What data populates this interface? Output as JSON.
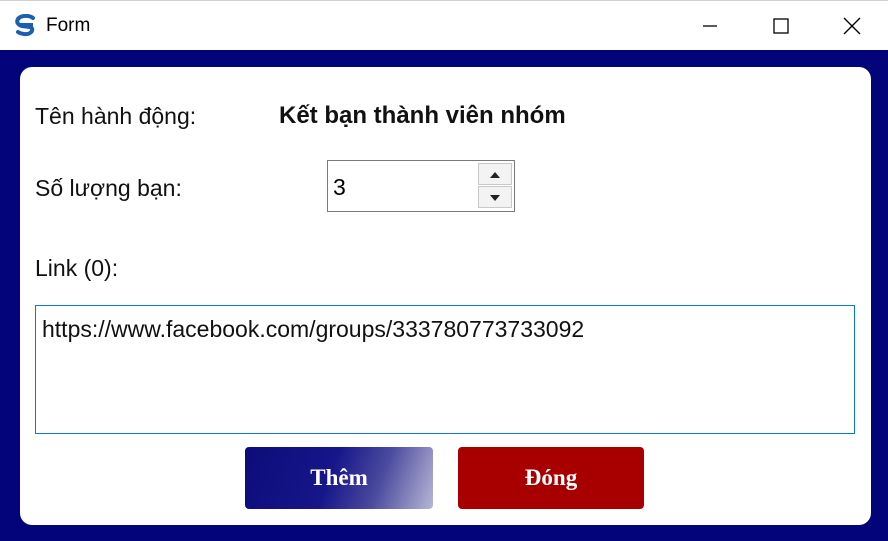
{
  "window": {
    "title": "Form",
    "app_icon": "app-logo-icon",
    "controls": {
      "minimize_icon": "minimize-icon",
      "maximize_icon": "maximize-icon",
      "close_icon": "close-icon"
    }
  },
  "form": {
    "action_label": "Tên hành động:",
    "action_value": "Kết bạn thành viên nhóm",
    "count_label": "Số lượng bạn:",
    "count_value": "3",
    "link_label": "Link (0):",
    "link_value": "https://www.facebook.com/groups/333780773733092"
  },
  "buttons": {
    "add_label": "Thêm",
    "close_label": "Đóng"
  },
  "colors": {
    "frame": "#04047a",
    "add_button": "#16168a",
    "close_button": "#a80000",
    "link_border": "#0a78d4"
  }
}
